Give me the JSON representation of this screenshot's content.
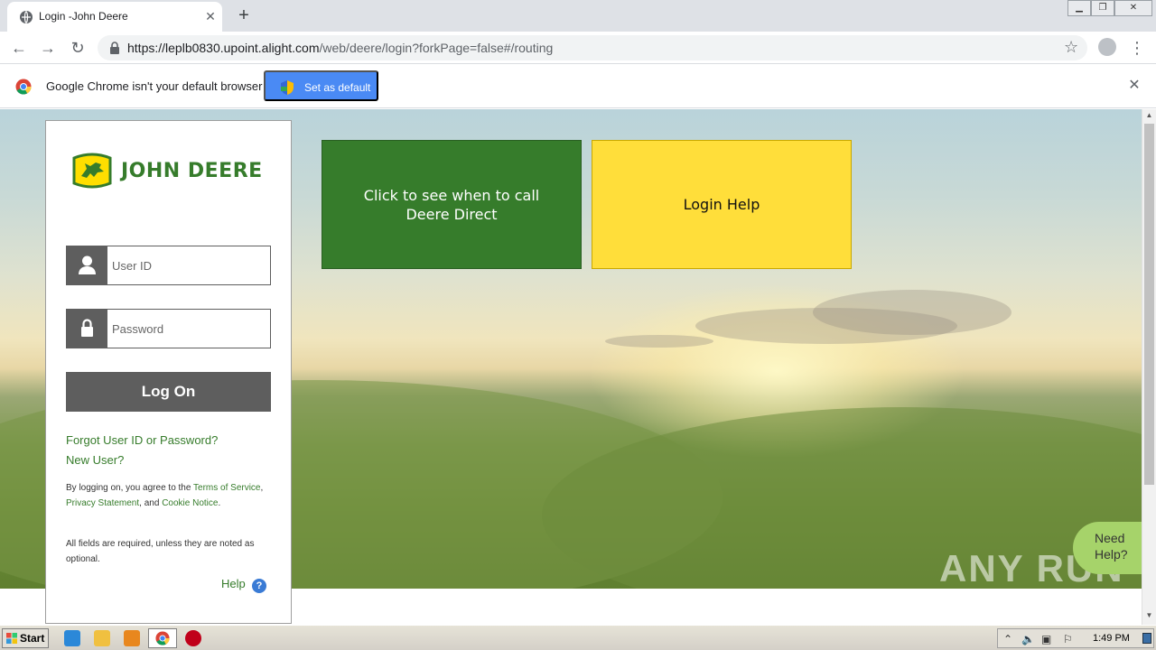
{
  "browser": {
    "tab_title": "Login -John Deere",
    "url_host": "https://leplb0830.upoint.alight.com",
    "url_path": "/web/deere/login?forkPage=false#/routing",
    "infobar_text": "Google Chrome isn't your default browser",
    "set_default_label": "Set as default"
  },
  "login": {
    "brand": "JOHN DEERE",
    "user_placeholder": "User ID",
    "password_placeholder": "Password",
    "logon_label": "Log On",
    "forgot_label": "Forgot User ID or Password?",
    "new_user_label": "New User?",
    "legal_prefix": "By logging on, you agree to the ",
    "terms_label": "Terms of Service",
    "privacy_label": "Privacy Statement",
    "cookie_label": "Cookie Notice",
    "legal_and": ", and ",
    "required_note": "All fields are required, unless they are noted as optional.",
    "help_label": "Help"
  },
  "tiles": {
    "deere_direct": "Click to see when to call Deere Direct",
    "login_help": "Login Help"
  },
  "need_help": "Need Help?",
  "watermark": "ANY RUN",
  "taskbar": {
    "start_label": "Start",
    "clock": "1:49 PM"
  },
  "colors": {
    "deere_green": "#367c2b",
    "deere_yellow": "#ffde3a",
    "chrome_blue": "#4a8af4"
  }
}
